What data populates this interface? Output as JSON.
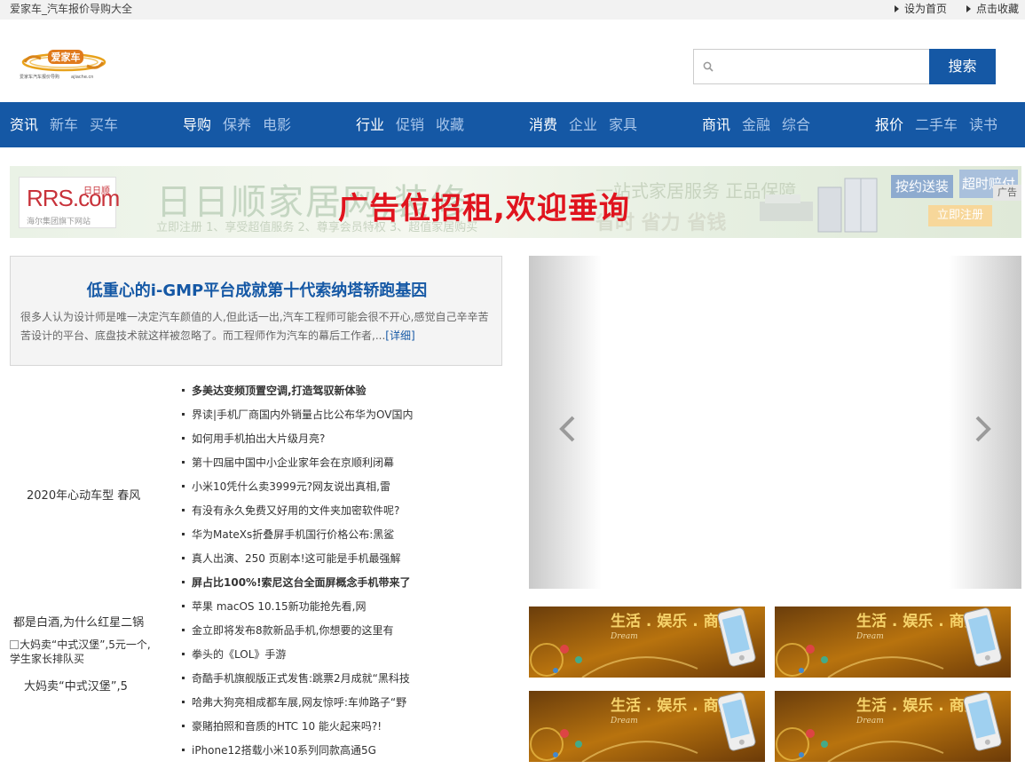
{
  "topbar": {
    "site_title": "爱家车_汽车报价导购大全",
    "set_home": "设为首页",
    "bookmark": "点击收藏"
  },
  "logo": {
    "brand_text": "爱家车",
    "slogan": "爱家车汽车报价导购",
    "domain_text": "ajiache.cn"
  },
  "search": {
    "placeholder": "",
    "button": "搜索"
  },
  "nav": {
    "groups": [
      {
        "main": "资讯",
        "subs": [
          "新车",
          "买车"
        ]
      },
      {
        "main": "导购",
        "subs": [
          "保养",
          "电影"
        ]
      },
      {
        "main": "行业",
        "subs": [
          "促销",
          "收藏"
        ]
      },
      {
        "main": "消费",
        "subs": [
          "企业",
          "家具"
        ]
      },
      {
        "main": "商讯",
        "subs": [
          "金融",
          "综合"
        ]
      },
      {
        "main": "报价",
        "subs": [
          "二手车",
          "读书"
        ]
      }
    ]
  },
  "banner": {
    "logo_text": "RRS.com",
    "logo_tag": "日日顺",
    "logo_sub": "海尔集团旗下网站",
    "bg_title": "日日顺家居网,装修",
    "bg_sub": "立即注册 1、享受超值服务 2、尊享会员特权 3、超值家居购买",
    "headline": "广告位招租,欢迎垂询",
    "bg_mid": "一站式家居服务 正品保障",
    "bg_right": "省时 省力 省钱",
    "tag1": "按约送装",
    "tag2": "超时赔付",
    "tag3": "立即注册",
    "ad_label": "广告"
  },
  "headline": {
    "title": "低重心的i-GMP平台成就第十代索纳塔轿跑基因",
    "summary": "很多人认为设计师是唯一决定汽车颜值的人,但此话一出,汽车工程师可能会很不开心,感觉自己辛辛苦苦设计的平台、底盘技术就这样被忽略了。而工程师作为汽车的幕后工作者,...",
    "more": "[详细]"
  },
  "left_pics": {
    "pic1": "2020年心动车型 春风",
    "pic2": "都是白酒,为什么红星二锅",
    "pic3_alt": "大妈卖“中式汉堡”,5元一个,学生家长排队买",
    "pic3_caption": "大妈卖“中式汉堡”,5"
  },
  "news": [
    {
      "text": "多美达变频顶置空调,打造驾驭新体验",
      "bold": true
    },
    {
      "text": "界读|手机厂商国内外销量占比公布华为OV国内",
      "bold": false
    },
    {
      "text": "如何用手机拍出大片级月亮?",
      "bold": false
    },
    {
      "text": "第十四届中国中小企业家年会在京顺利闭幕",
      "bold": false
    },
    {
      "text": "小米10凭什么卖3999元?网友说出真相,雷",
      "bold": false
    },
    {
      "text": "有没有永久免费又好用的文件夹加密软件呢?",
      "bold": false
    },
    {
      "text": "华为MateXs折叠屏手机国行价格公布:黑鲨",
      "bold": false
    },
    {
      "text": "真人出演、250 页剧本!这可能是手机最强解",
      "bold": false
    },
    {
      "text": "屏占比100%!索尼这台全面屏概念手机带来了",
      "bold": true
    },
    {
      "text": "苹果 macOS 10.15新功能抢先看,网",
      "bold": false
    },
    {
      "text": "金立即将发布8款新品手机,你想要的这里有",
      "bold": false
    },
    {
      "text": "拳头的《LOL》手游",
      "bold": false
    },
    {
      "text": "奇酷手机旗舰版正式发售:跳票2月成就“黑科技",
      "bold": false
    },
    {
      "text": "哈弗大狗亮相成都车展,网友惊呼:车帅路子“野",
      "bold": false
    },
    {
      "text": "豪賭拍照和音质的HTC 10 能火起来吗?!",
      "bold": false
    },
    {
      "text": "iPhone12搭载小米10系列同款高通5G",
      "bold": false
    }
  ],
  "thumb": {
    "title": "生活 . 娱乐 . 商务",
    "script": "Dream"
  },
  "colors": {
    "brand_blue": "#1558a5",
    "nav_sub": "#a9c6ea",
    "ad_red": "#e0141e"
  }
}
